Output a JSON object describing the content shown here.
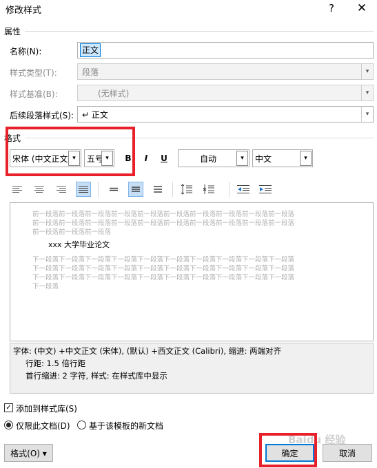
{
  "window": {
    "title": "修改样式",
    "help": "?",
    "close": "✕"
  },
  "properties": {
    "section_label": "属性",
    "name_label": "名称(N):",
    "name_value": "正文",
    "style_type_label": "样式类型(T):",
    "style_type_value": "段落",
    "style_based_label": "样式基准(B):",
    "style_based_value": "(无样式)",
    "next_style_label": "后续段落样式(S):",
    "next_style_value": "↵ 正文"
  },
  "format": {
    "section_label": "格式",
    "font": "宋体 (中文正文)",
    "size": "五号",
    "bold": "B",
    "italic": "I",
    "underline": "U",
    "color": "自动",
    "lang": "中文"
  },
  "preview": {
    "prev_lines": [
      "前一段落前一段落前一段落前一段落前一段落前一段落前一段落前一段落前一段落前一段落",
      "前一段落前一段落前一段落前一段落前一段落前一段落前一段落前一段落前一段落前一段落",
      "前一段落前一段落前一段落"
    ],
    "sample_text": "xxx 大学毕业论文",
    "next_lines": [
      "下一段落下一段落下一段落下一段落下一段落下一段落下一段落下一段落下一段落下一段落",
      "下一段落下一段落下一段落下一段落下一段落下一段落下一段落下一段落下一段落下一段落",
      "下一段落下一段落下一段落下一段落下一段落下一段落下一段落下一段落下一段落下一段落",
      "下一段落"
    ]
  },
  "description": {
    "line1": "字体: (中文) +中文正文 (宋体), (默认) +西文正文 (Calibri), 缩进: 两端对齐",
    "line2": "行距: 1.5 倍行距",
    "line3": "首行缩进:  2 字符, 样式: 在样式库中显示"
  },
  "options": {
    "add_to_gallery": "添加到样式库(S)",
    "only_this_doc": "仅限此文档(D)",
    "based_on_template": "基于该模板的新文档"
  },
  "buttons": {
    "format_menu": "格式(O) ▾",
    "ok": "确定",
    "cancel": "取消"
  },
  "watermark": "Baidu 经验",
  "colors": {
    "highlight_red": "#e8202a",
    "selection_blue": "#cce8ff",
    "focus_blue": "#0078d7"
  }
}
